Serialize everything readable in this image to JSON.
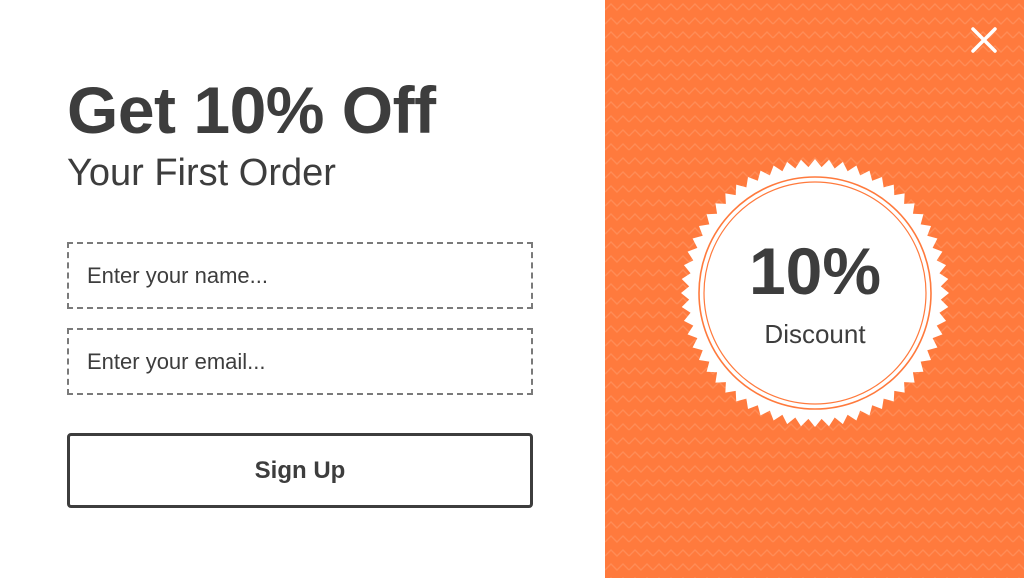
{
  "offer": {
    "headline": "Get 10% Off",
    "subheadline": "Your First Order"
  },
  "form": {
    "name_placeholder": "Enter your name...",
    "email_placeholder": "Enter your email...",
    "submit_label": "Sign Up"
  },
  "badge": {
    "value": "10%",
    "label": "Discount"
  },
  "icons": {
    "close": "close-icon"
  },
  "colors": {
    "accent": "#ff7a3d",
    "text": "#3d3d3d",
    "background": "#ffffff"
  }
}
